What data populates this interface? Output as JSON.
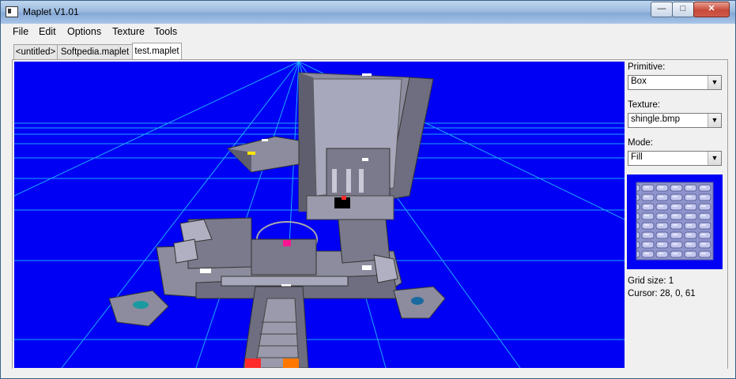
{
  "window": {
    "title": "Maplet V1.01"
  },
  "titlebar_buttons": {
    "minimize": "—",
    "maximize": "□",
    "close": "✕"
  },
  "menu": [
    {
      "label": "File"
    },
    {
      "label": "Edit"
    },
    {
      "label": "Options"
    },
    {
      "label": "Texture"
    },
    {
      "label": "Tools"
    }
  ],
  "tabs": [
    {
      "label": "<untitled>",
      "active": false
    },
    {
      "label": "Softpedia.maplet",
      "active": false
    },
    {
      "label": "test.maplet",
      "active": true
    }
  ],
  "sidebar": {
    "primitive": {
      "label": "Primitive:",
      "value": "Box"
    },
    "texture": {
      "label": "Texture:",
      "value": "shingle.bmp"
    },
    "mode": {
      "label": "Mode:",
      "value": "Fill"
    },
    "grid_size": "Grid size: 1",
    "cursor": "Cursor: 28, 0, 61",
    "dropdown_arrow": "▼"
  },
  "colors": {
    "viewport_bg": "#0000f4",
    "grid_line": "#22bbff",
    "wall": "#8c8c9e",
    "wall_dark": "#5e5e6e",
    "marker_red": "#ff2a2a",
    "marker_pink": "#ff1493",
    "marker_orange": "#ff7700",
    "marker_teal": "#1a9aa0",
    "marker_yellow": "#ffe600",
    "marker_blue": "#1a6aa0"
  }
}
